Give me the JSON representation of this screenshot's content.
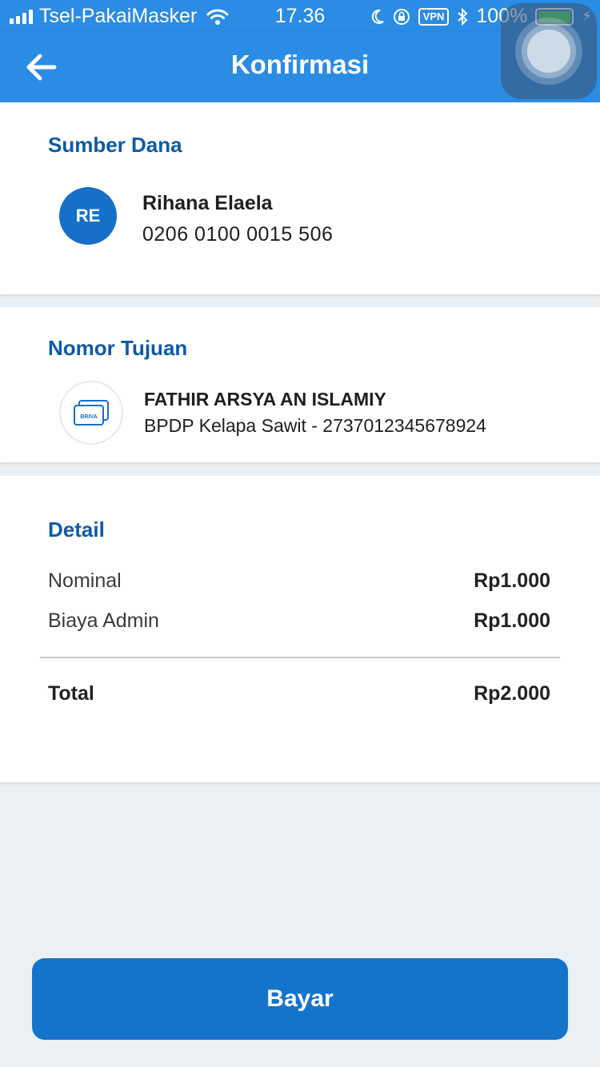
{
  "status_bar": {
    "carrier": "Tsel-PakaiMasker",
    "time": "17.36",
    "vpn": "VPN",
    "battery": "100%"
  },
  "nav": {
    "title": "Konfirmasi"
  },
  "source": {
    "title": "Sumber Dana",
    "initials": "RE",
    "name": "Rihana Elaela",
    "account": "0206 0100 0015 506"
  },
  "destination": {
    "title": "Nomor Tujuan",
    "icon_label": "BRIVA",
    "name": "FATHIR ARSYA AN ISLAMIY",
    "info": "BPDP Kelapa Sawit - 2737012345678924"
  },
  "detail": {
    "title": "Detail",
    "rows": [
      {
        "label": "Nominal",
        "value": "Rp1.000"
      },
      {
        "label": "Biaya Admin",
        "value": "Rp1.000"
      }
    ],
    "total_label": "Total",
    "total_value": "Rp2.000"
  },
  "pay_button": "Bayar",
  "colors": {
    "primary": "#2a8ce4",
    "button": "#1474cb",
    "section_title": "#0d5aa8"
  }
}
